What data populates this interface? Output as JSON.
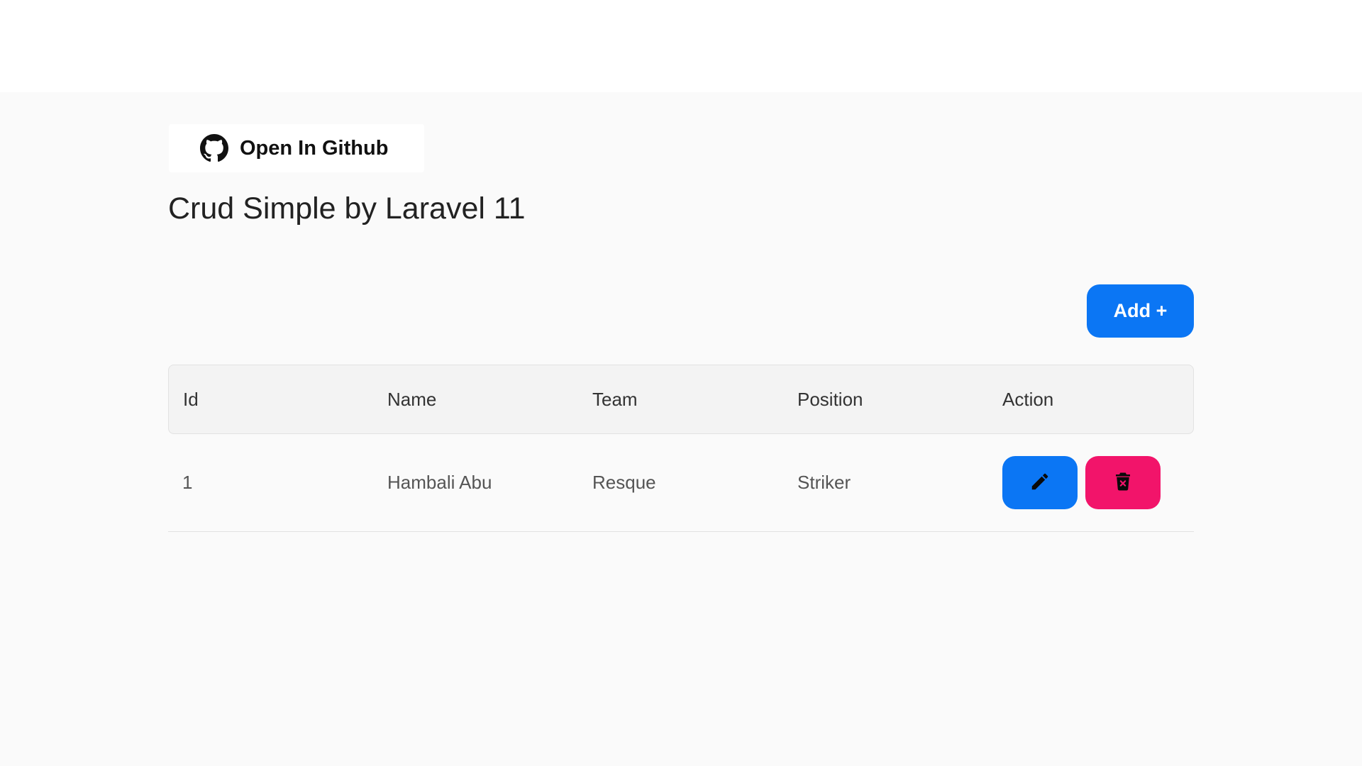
{
  "header": {
    "github_label": "Open In Github",
    "github_icon": "github-icon"
  },
  "page": {
    "title": "Crud Simple by Laravel 11"
  },
  "toolbar": {
    "add_label": "Add +"
  },
  "table": {
    "columns": [
      "Id",
      "Name",
      "Team",
      "Position",
      "Action"
    ],
    "rows": [
      {
        "id": "1",
        "name": "Hambali Abu",
        "team": "Resque",
        "position": "Striker",
        "actions": {
          "edit_icon": "pencil-icon",
          "delete_icon": "trash-icon"
        }
      }
    ]
  },
  "colors": {
    "primary": "#0b76f4",
    "danger": "#f2146a",
    "page_background": "#fafafa",
    "header_background": "#f3f3f3"
  }
}
